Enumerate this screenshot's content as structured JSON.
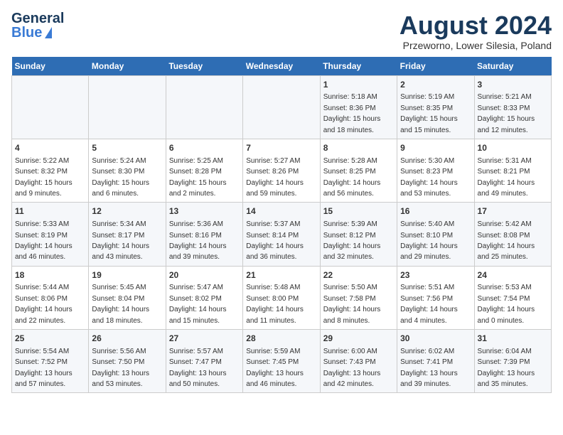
{
  "logo": {
    "general": "General",
    "blue": "Blue"
  },
  "header": {
    "title": "August 2024",
    "subtitle": "Przeworno, Lower Silesia, Poland"
  },
  "weekdays": [
    "Sunday",
    "Monday",
    "Tuesday",
    "Wednesday",
    "Thursday",
    "Friday",
    "Saturday"
  ],
  "weeks": [
    [
      {
        "day": "",
        "info": ""
      },
      {
        "day": "",
        "info": ""
      },
      {
        "day": "",
        "info": ""
      },
      {
        "day": "",
        "info": ""
      },
      {
        "day": "1",
        "info": "Sunrise: 5:18 AM\nSunset: 8:36 PM\nDaylight: 15 hours\nand 18 minutes."
      },
      {
        "day": "2",
        "info": "Sunrise: 5:19 AM\nSunset: 8:35 PM\nDaylight: 15 hours\nand 15 minutes."
      },
      {
        "day": "3",
        "info": "Sunrise: 5:21 AM\nSunset: 8:33 PM\nDaylight: 15 hours\nand 12 minutes."
      }
    ],
    [
      {
        "day": "4",
        "info": "Sunrise: 5:22 AM\nSunset: 8:32 PM\nDaylight: 15 hours\nand 9 minutes."
      },
      {
        "day": "5",
        "info": "Sunrise: 5:24 AM\nSunset: 8:30 PM\nDaylight: 15 hours\nand 6 minutes."
      },
      {
        "day": "6",
        "info": "Sunrise: 5:25 AM\nSunset: 8:28 PM\nDaylight: 15 hours\nand 2 minutes."
      },
      {
        "day": "7",
        "info": "Sunrise: 5:27 AM\nSunset: 8:26 PM\nDaylight: 14 hours\nand 59 minutes."
      },
      {
        "day": "8",
        "info": "Sunrise: 5:28 AM\nSunset: 8:25 PM\nDaylight: 14 hours\nand 56 minutes."
      },
      {
        "day": "9",
        "info": "Sunrise: 5:30 AM\nSunset: 8:23 PM\nDaylight: 14 hours\nand 53 minutes."
      },
      {
        "day": "10",
        "info": "Sunrise: 5:31 AM\nSunset: 8:21 PM\nDaylight: 14 hours\nand 49 minutes."
      }
    ],
    [
      {
        "day": "11",
        "info": "Sunrise: 5:33 AM\nSunset: 8:19 PM\nDaylight: 14 hours\nand 46 minutes."
      },
      {
        "day": "12",
        "info": "Sunrise: 5:34 AM\nSunset: 8:17 PM\nDaylight: 14 hours\nand 43 minutes."
      },
      {
        "day": "13",
        "info": "Sunrise: 5:36 AM\nSunset: 8:16 PM\nDaylight: 14 hours\nand 39 minutes."
      },
      {
        "day": "14",
        "info": "Sunrise: 5:37 AM\nSunset: 8:14 PM\nDaylight: 14 hours\nand 36 minutes."
      },
      {
        "day": "15",
        "info": "Sunrise: 5:39 AM\nSunset: 8:12 PM\nDaylight: 14 hours\nand 32 minutes."
      },
      {
        "day": "16",
        "info": "Sunrise: 5:40 AM\nSunset: 8:10 PM\nDaylight: 14 hours\nand 29 minutes."
      },
      {
        "day": "17",
        "info": "Sunrise: 5:42 AM\nSunset: 8:08 PM\nDaylight: 14 hours\nand 25 minutes."
      }
    ],
    [
      {
        "day": "18",
        "info": "Sunrise: 5:44 AM\nSunset: 8:06 PM\nDaylight: 14 hours\nand 22 minutes."
      },
      {
        "day": "19",
        "info": "Sunrise: 5:45 AM\nSunset: 8:04 PM\nDaylight: 14 hours\nand 18 minutes."
      },
      {
        "day": "20",
        "info": "Sunrise: 5:47 AM\nSunset: 8:02 PM\nDaylight: 14 hours\nand 15 minutes."
      },
      {
        "day": "21",
        "info": "Sunrise: 5:48 AM\nSunset: 8:00 PM\nDaylight: 14 hours\nand 11 minutes."
      },
      {
        "day": "22",
        "info": "Sunrise: 5:50 AM\nSunset: 7:58 PM\nDaylight: 14 hours\nand 8 minutes."
      },
      {
        "day": "23",
        "info": "Sunrise: 5:51 AM\nSunset: 7:56 PM\nDaylight: 14 hours\nand 4 minutes."
      },
      {
        "day": "24",
        "info": "Sunrise: 5:53 AM\nSunset: 7:54 PM\nDaylight: 14 hours\nand 0 minutes."
      }
    ],
    [
      {
        "day": "25",
        "info": "Sunrise: 5:54 AM\nSunset: 7:52 PM\nDaylight: 13 hours\nand 57 minutes."
      },
      {
        "day": "26",
        "info": "Sunrise: 5:56 AM\nSunset: 7:50 PM\nDaylight: 13 hours\nand 53 minutes."
      },
      {
        "day": "27",
        "info": "Sunrise: 5:57 AM\nSunset: 7:47 PM\nDaylight: 13 hours\nand 50 minutes."
      },
      {
        "day": "28",
        "info": "Sunrise: 5:59 AM\nSunset: 7:45 PM\nDaylight: 13 hours\nand 46 minutes."
      },
      {
        "day": "29",
        "info": "Sunrise: 6:00 AM\nSunset: 7:43 PM\nDaylight: 13 hours\nand 42 minutes."
      },
      {
        "day": "30",
        "info": "Sunrise: 6:02 AM\nSunset: 7:41 PM\nDaylight: 13 hours\nand 39 minutes."
      },
      {
        "day": "31",
        "info": "Sunrise: 6:04 AM\nSunset: 7:39 PM\nDaylight: 13 hours\nand 35 minutes."
      }
    ]
  ]
}
